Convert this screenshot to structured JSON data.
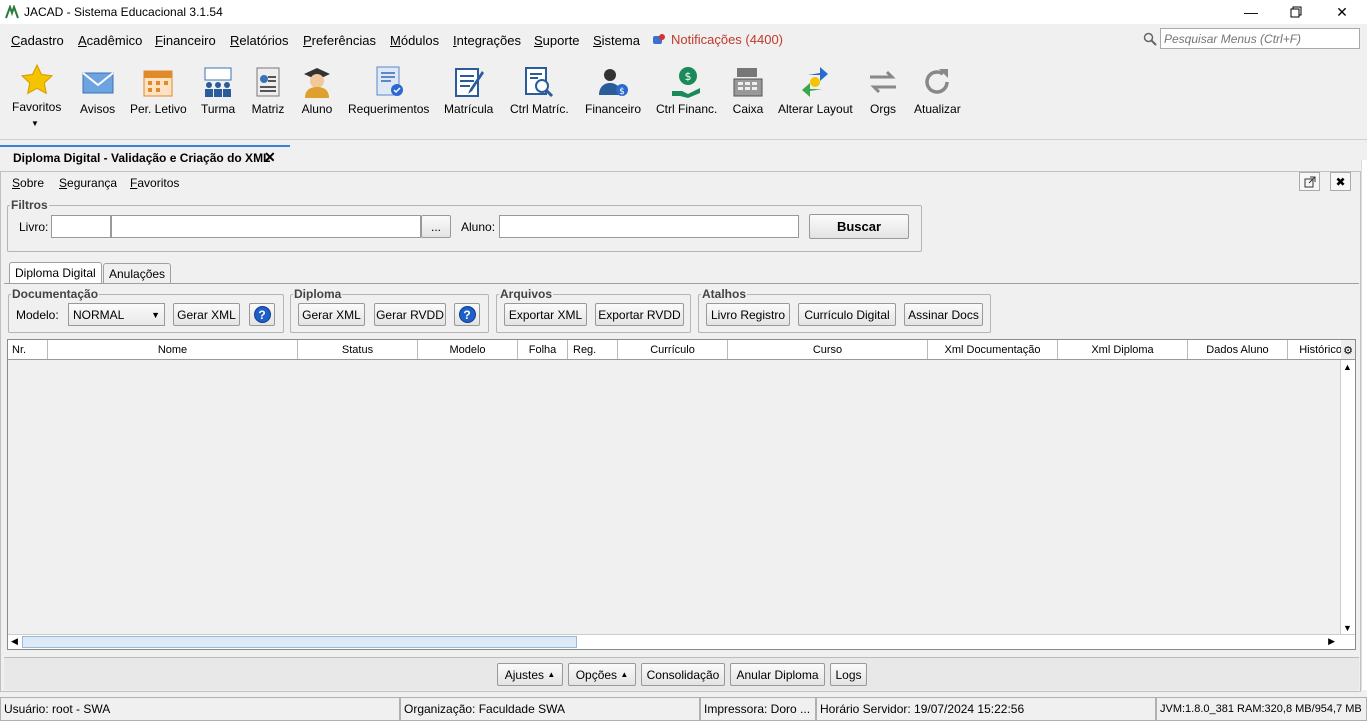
{
  "window": {
    "title": "JACAD - Sistema Educacional 3.1.54"
  },
  "menubar": {
    "items": [
      "Cadastro",
      "Acadêmico",
      "Financeiro",
      "Relatórios",
      "Preferências",
      "Módulos",
      "Integrações",
      "Suporte",
      "Sistema"
    ],
    "notifications": "Notificações (4400)",
    "search_placeholder": "Pesquisar Menus (Ctrl+F)"
  },
  "toolbar": {
    "items": [
      "Favoritos",
      "Avisos",
      "Per. Letivo",
      "Turma",
      "Matriz",
      "Aluno",
      "Requerimentos",
      "Matrícula",
      "Ctrl Matríc.",
      "Financeiro",
      "Ctrl Financ.",
      "Caixa",
      "Alterar Layout",
      "Orgs",
      "Atualizar"
    ]
  },
  "doc_tab": {
    "title": "Diploma Digital - Validação e Criação do XML"
  },
  "submenu": [
    "Sobre",
    "Segurança",
    "Favoritos"
  ],
  "filters": {
    "legend": "Filtros",
    "livro_label": "Livro:",
    "ellipsis": "...",
    "aluno_label": "Aluno:",
    "buscar": "Buscar"
  },
  "inner_tabs": [
    "Diploma Digital",
    "Anulações"
  ],
  "groups": {
    "documentacao": {
      "legend": "Documentação",
      "modelo_label": "Modelo:",
      "modelo_value": "NORMAL",
      "gerar_xml": "Gerar XML",
      "help": "?"
    },
    "diploma": {
      "legend": "Diploma",
      "gerar_xml": "Gerar XML",
      "gerar_rvdd": "Gerar RVDD",
      "help": "?"
    },
    "arquivos": {
      "legend": "Arquivos",
      "exportar_xml": "Exportar XML",
      "exportar_rvdd": "Exportar RVDD"
    },
    "atalhos": {
      "legend": "Atalhos",
      "livro_registro": "Livro Registro",
      "curriculo_digital": "Currículo Digital",
      "assinar_docs": "Assinar Docs"
    }
  },
  "table": {
    "columns": [
      "Nr.",
      "Nome",
      "Status",
      "Modelo",
      "Folha",
      "Reg.",
      "Currículo",
      "Curso",
      "Xml Documentação",
      "Xml Diploma",
      "Dados Aluno",
      "Histórico"
    ],
    "rows": []
  },
  "bottom_buttons": {
    "ajustes": "Ajustes",
    "opcoes": "Opções",
    "consolidacao": "Consolidação",
    "anular": "Anular Diploma",
    "logs": "Logs"
  },
  "status": {
    "usuario": "Usuário: root - SWA",
    "organizacao": "Organização: Faculdade SWA",
    "impressora": "Impressora: Doro ...",
    "horario": "Horário Servidor: 19/07/2024 15:22:56",
    "jvm": "JVM:1.8.0_381  RAM:320,8 MB/954,7 MB"
  }
}
